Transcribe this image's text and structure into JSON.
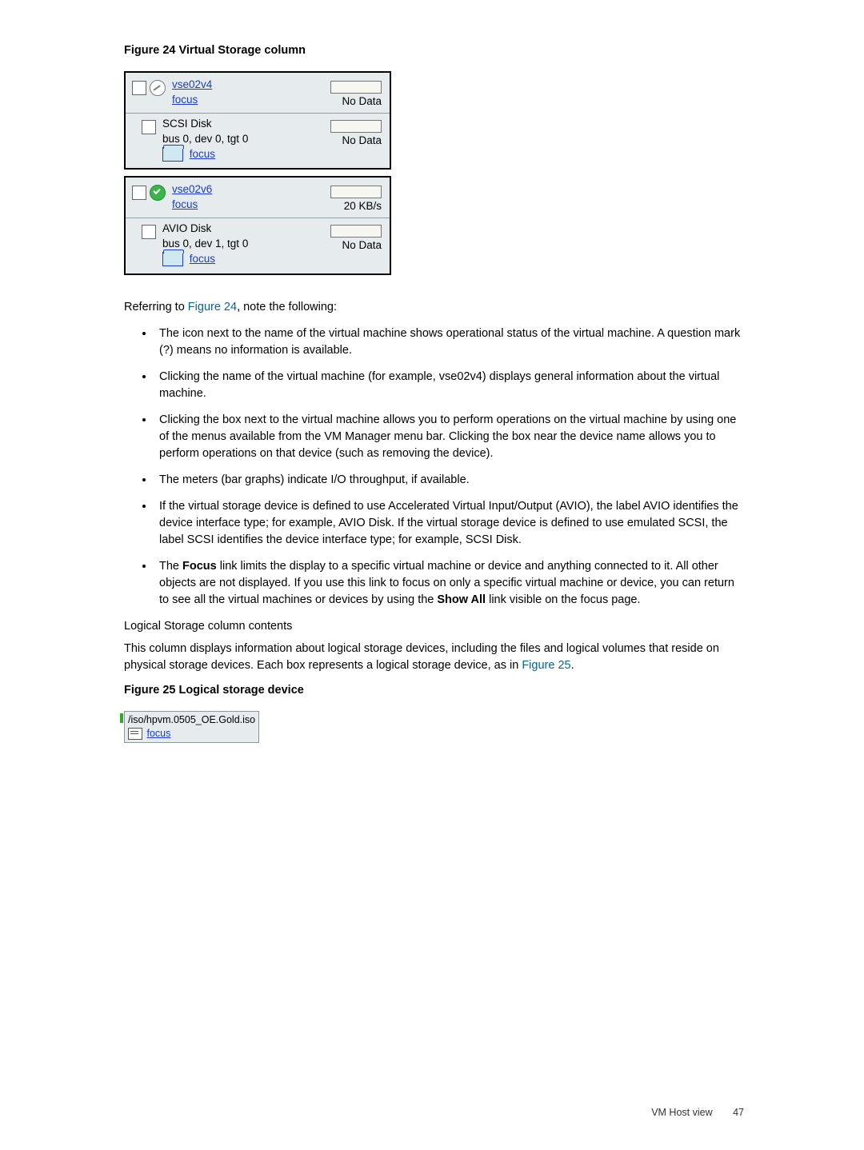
{
  "figure24": {
    "caption": "Figure 24 Virtual Storage column",
    "vm1": {
      "name": "vse02v4",
      "focus": "focus",
      "meter": "No Data",
      "disk": {
        "label": "SCSI Disk",
        "bus": "bus 0, dev 0, tgt 0",
        "focus": "focus",
        "meter": "No Data"
      }
    },
    "vm2": {
      "name": "vse02v6",
      "focus": "focus",
      "meter": "20 KB/s",
      "disk": {
        "label": "AVIO Disk",
        "bus": "bus 0, dev 1, tgt 0",
        "focus": "focus",
        "meter": "No Data"
      }
    }
  },
  "body": {
    "intro_a": "Referring to ",
    "intro_link": "Figure 24",
    "intro_b": ", note the following:",
    "b1": "The icon next to the name of the virtual machine shows operational status of the virtual machine. A question mark (?) means no information is available.",
    "b2": "Clicking the name of the virtual machine (for example, vse02v4) displays general information about the virtual machine.",
    "b3": "Clicking the box next to the virtual machine allows you to perform operations on the virtual machine by using one of the menus available from the VM Manager menu bar. Clicking the box near the device name allows you to perform operations on that device (such as removing the device).",
    "b4": "The meters (bar graphs) indicate I/O throughput, if available.",
    "b5": "If the virtual storage device is defined to use Accelerated Virtual Input/Output (AVIO), the label AVIO identifies the device interface type; for example, AVIO Disk. If the virtual storage device is defined to use emulated SCSI, the label SCSI identifies the device interface type; for example, SCSI Disk.",
    "b6_a": "The ",
    "b6_focus": "Focus",
    "b6_b": " link limits the display to a specific virtual machine or device and anything connected to it. All other objects are not displayed. If you use this link to focus on only a specific virtual machine or device, you can return to see all the virtual machines or devices by using the ",
    "b6_show": "Show All",
    "b6_c": " link visible on the focus page.",
    "section": "Logical Storage column contents",
    "para2_a": "This column displays information about logical storage devices, including the files and logical volumes that reside on physical storage devices. Each box represents a logical storage device, as in ",
    "para2_link": "Figure 25",
    "para2_b": "."
  },
  "figure25": {
    "caption": "Figure 25 Logical storage device",
    "path": "/iso/hpvm.0505_OE.Gold.iso",
    "focus": "focus"
  },
  "footer": {
    "section": "VM Host view",
    "page": "47"
  }
}
